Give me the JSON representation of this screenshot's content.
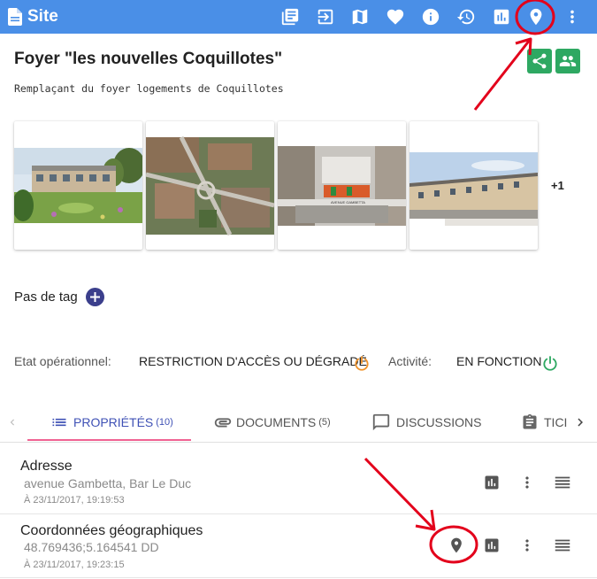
{
  "topbar": {
    "title": "Site",
    "icons": [
      "document-icon",
      "exit-to-app-icon",
      "map-icon",
      "heart-icon",
      "info-icon",
      "history-icon",
      "bar-chart-icon",
      "map-marker-icon",
      "more-vert-icon"
    ]
  },
  "site": {
    "title": "Foyer \"les nouvelles Coquillotes\"",
    "subtitle": "Remplaçant du foyer logements de Coquillotes"
  },
  "gallery": {
    "more_count": "+1"
  },
  "tags": {
    "label": "Pas de tag"
  },
  "status": {
    "operational_label": "Etat opérationnel:",
    "operational_value": "RESTRICTION D'ACCÈS OU DÉGRADÉ",
    "activity_label": "Activité:",
    "activity_value": "EN FONCTION",
    "colors": {
      "degraded": "#f0932b",
      "ok": "#2ea862"
    }
  },
  "tabs": [
    {
      "label": "PROPRIÉTÉS",
      "count": "(10)"
    },
    {
      "label": "DOCUMENTS",
      "count": "(5)"
    },
    {
      "label": "DISCUSSIONS",
      "count": ""
    },
    {
      "label": "TICI",
      "count": ""
    }
  ],
  "properties": [
    {
      "name": "Adresse",
      "value": "avenue Gambetta, Bar Le Duc",
      "date": "À 23/11/2017, 19:19:53"
    },
    {
      "name": "Coordonnées géographiques",
      "value": "48.769436;5.164541 DD",
      "date": "À 23/11/2017, 19:23:15"
    }
  ],
  "colors": {
    "topbar": "#4a8fe7",
    "accent": "#3f51b5",
    "tab_underline": "#f06292",
    "share_green": "#2ea862",
    "annotation_red": "#e3001b"
  }
}
